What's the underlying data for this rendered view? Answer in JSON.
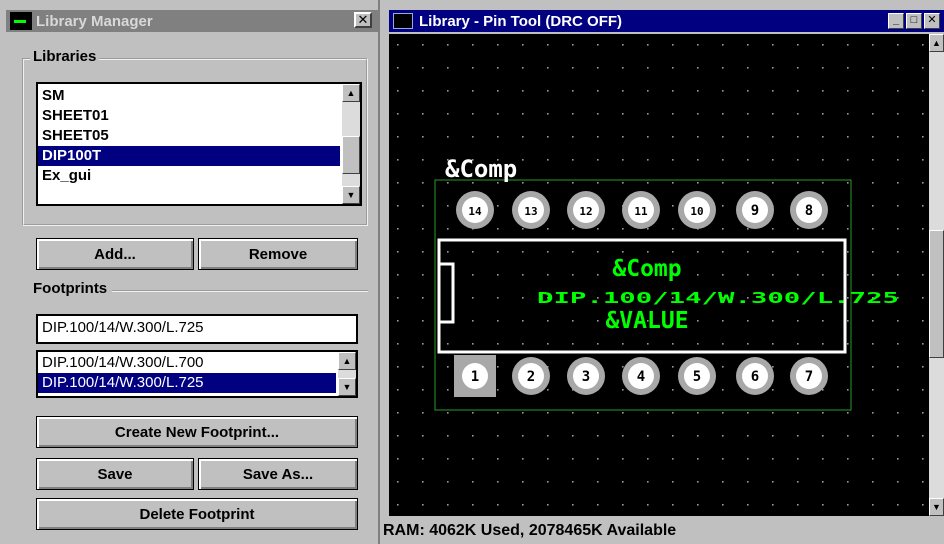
{
  "library_manager": {
    "title": "Library Manager",
    "close_glyph": "✕",
    "libraries": {
      "label": "Libraries",
      "items": [
        "SM",
        "SHEET01",
        "SHEET05",
        "DIP100T",
        "Ex_gui"
      ],
      "selected": "DIP100T"
    },
    "add_label": "Add...",
    "remove_label": "Remove",
    "footprints": {
      "label": "Footprints",
      "filter_value": "DIP.100/14/W.300/L.725",
      "items": [
        "DIP.100/14/W.300/L.700",
        "DIP.100/14/W.300/L.725"
      ],
      "selected": "DIP.100/14/W.300/L.725"
    },
    "create_new_label": "Create New Footprint...",
    "save_label": "Save",
    "save_as_label": "Save As...",
    "delete_label": "Delete Footprint"
  },
  "pin_tool": {
    "title": "Library - Pin Tool (DRC OFF)",
    "canvas": {
      "ref_label": "&Comp",
      "body_ref_label": "&Comp",
      "footprint_label": "DIP.100/14/W.300/L.725",
      "value_label": "&VALUE",
      "top_pins": [
        "14",
        "13",
        "12",
        "11",
        "10",
        "9",
        "8"
      ],
      "bottom_pins": [
        "1",
        "2",
        "3",
        "4",
        "5",
        "6",
        "7"
      ]
    },
    "status": "RAM: 4062K Used, 2078465K Available"
  },
  "colors": {
    "title_active": "#000080",
    "title_inactive": "#808080",
    "selection": "#000080",
    "canvas_bg": "#000000",
    "silkscreen": "#00ff00",
    "outline": "#ffffff"
  }
}
